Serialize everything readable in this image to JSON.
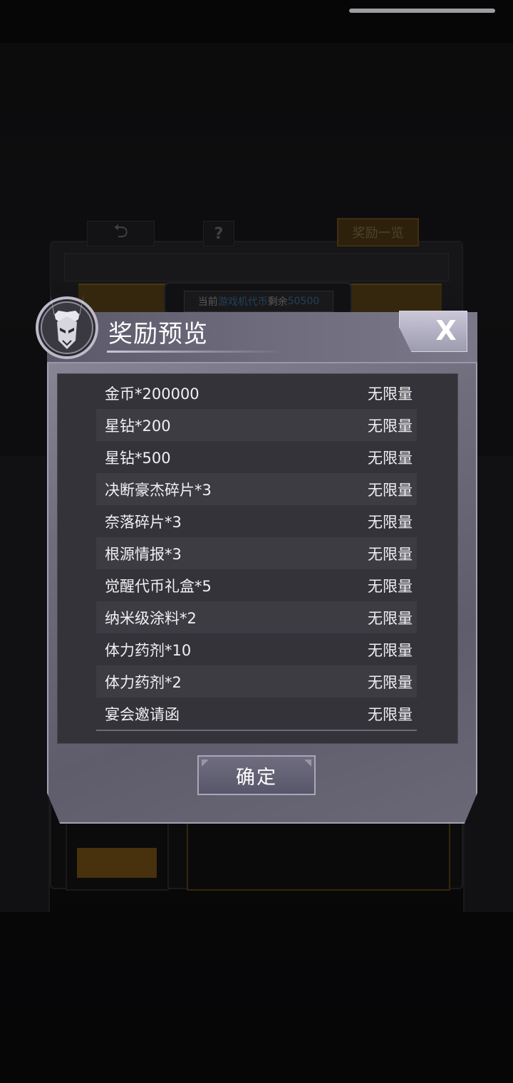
{
  "background": {
    "back_icon": "back-arrow-icon",
    "help_label": "?",
    "reward_list_label": "奖励一览",
    "coin_info": {
      "prefix": "当前",
      "currency": "游戏机代币",
      "middle": "剩余",
      "amount": "50500"
    }
  },
  "dialog": {
    "title": "奖励预览",
    "close_label": "X",
    "items": [
      {
        "name": "金币*200000",
        "quantity": "无限量"
      },
      {
        "name": "星钻*200",
        "quantity": "无限量"
      },
      {
        "name": "星钻*500",
        "quantity": "无限量"
      },
      {
        "name": "决断豪杰碎片*3",
        "quantity": "无限量"
      },
      {
        "name": "奈落碎片*3",
        "quantity": "无限量"
      },
      {
        "name": "根源情报*3",
        "quantity": "无限量"
      },
      {
        "name": "觉醒代币礼盒*5",
        "quantity": "无限量"
      },
      {
        "name": "纳米级涂料*2",
        "quantity": "无限量"
      },
      {
        "name": "体力药剂*10",
        "quantity": "无限量"
      },
      {
        "name": "体力药剂*2",
        "quantity": "无限量"
      },
      {
        "name": "宴会邀请函",
        "quantity": "无限量"
      }
    ],
    "confirm_label": "确定"
  },
  "colors": {
    "dialog_bg": "#6f6d7c",
    "list_bg": "#343339",
    "accent_orange": "#6e521c",
    "highlight_blue": "#3b6f9c"
  }
}
